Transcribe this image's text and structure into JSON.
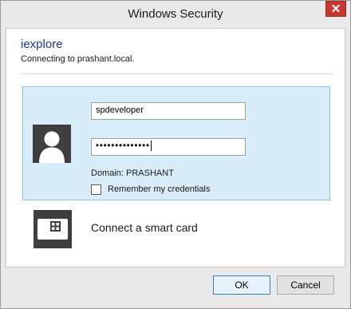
{
  "window": {
    "title": "Windows Security",
    "close_glyph": "✕"
  },
  "prompt": {
    "app_name": "iexplore",
    "message": "Connecting to prashant.local."
  },
  "credentials": {
    "username": "spdeveloper",
    "password_mask": "••••••••••••••",
    "domain": "Domain: PRASHANT",
    "remember_label": "Remember my credentials",
    "remember_checked": false,
    "avatar_icon": "user-avatar-icon"
  },
  "smartcard": {
    "label": "Connect a smart card",
    "icon": "smart-card-icon"
  },
  "buttons": {
    "ok": "OK",
    "cancel": "Cancel"
  },
  "colors": {
    "tile_background": "#d9ecfa",
    "tile_border": "#8fc0e8",
    "app_name_color": "#1f3c88",
    "close_button": "#c7372f"
  }
}
